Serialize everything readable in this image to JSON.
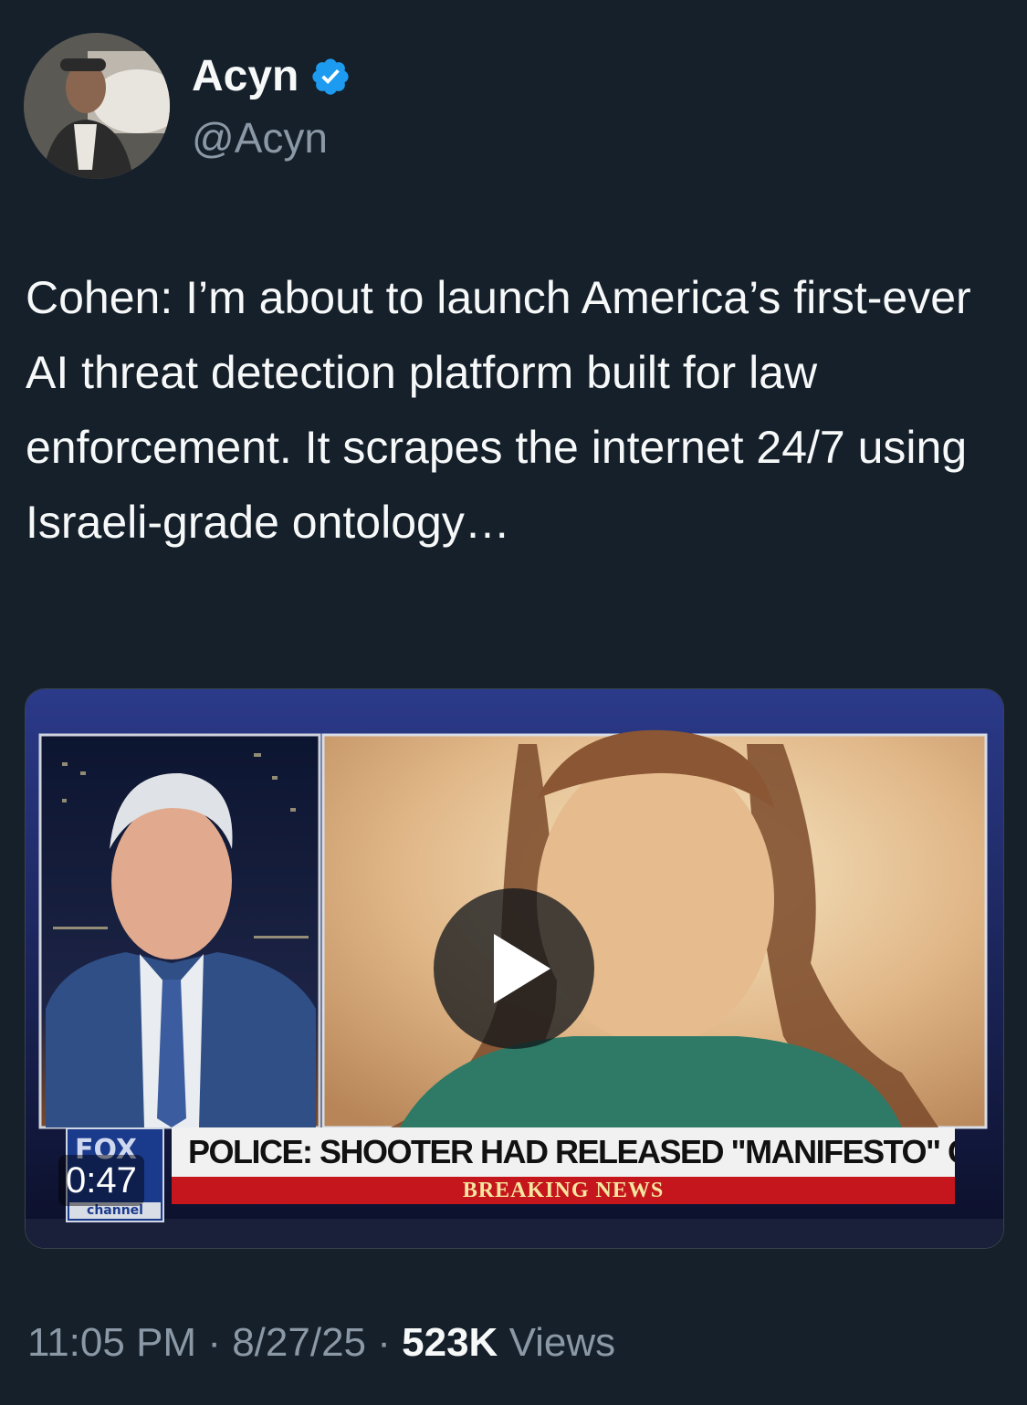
{
  "author": {
    "name": "Acyn",
    "handle": "@Acyn",
    "verified": true,
    "verified_color": "#1d9bf0"
  },
  "tweet": {
    "text": "Cohen: I’m about to launch America’s first-ever AI threat detection platform built for law enforcement. It scrapes the internet 24/7 using Israeli-grade ontology…"
  },
  "media": {
    "type": "video",
    "duration": "0:47",
    "play_icon": "play-icon",
    "chyron_headline": "POLICE: SHOOTER HAD RELEASED \"MANIFESTO\" ONLINE",
    "chyron_banner": "BREAKING NEWS",
    "logo_word": "FOX",
    "logo_channel": "channel"
  },
  "meta": {
    "time": "11:05 PM",
    "date": "8/27/25",
    "separator": "·",
    "views_count": "523K",
    "views_label": "Views"
  },
  "colors": {
    "background": "#15202b",
    "text": "#f7f9f9",
    "secondary_text": "#8b98a5",
    "breaking_red": "#c4161c"
  }
}
